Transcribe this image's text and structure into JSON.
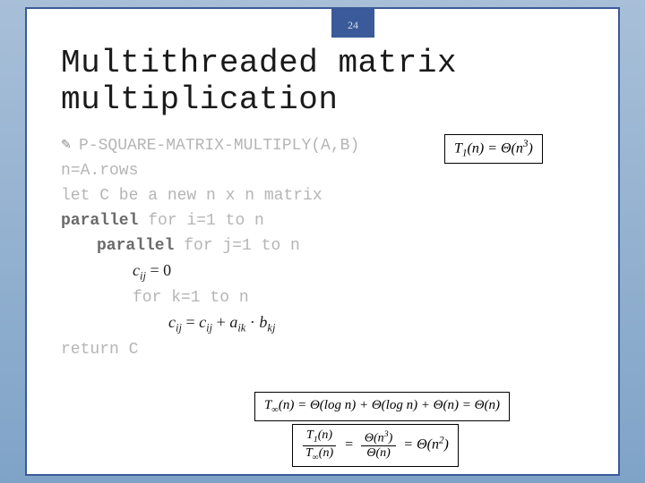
{
  "page_number": "24",
  "title_line1": "Multithreaded matrix",
  "title_line2": "multiplication",
  "code": {
    "l1": "P-SQUARE-MATRIX-MULTIPLY(A,B)",
    "l2": "n=A.rows",
    "l3": "let C be a new n x n matrix",
    "l4a": "parallel",
    "l4b": " for i=1 to n",
    "l5a": "parallel",
    "l5b": " for j=1 to n",
    "l6": "cᵢⱼ = 0",
    "l7": "for k=1 to n",
    "l8": "cᵢⱼ = cᵢⱼ + aᵢₖ · bₖⱼ",
    "l9": "return C"
  },
  "box1": "T₁(n) = Θ(n³)",
  "box2": "T∞(n) = Θ(log n) + Θ(log n) + Θ(n) = Θ(n)",
  "box3_num_l": "T₁(n)",
  "box3_den_l": "T∞(n)",
  "box3_num_r": "Θ(n³)",
  "box3_den_r": "Θ(n)",
  "box3_rhs": "= Θ(n²)"
}
